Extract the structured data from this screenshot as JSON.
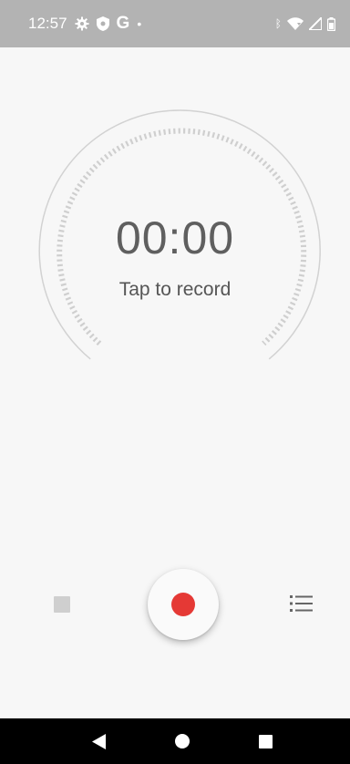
{
  "status_bar": {
    "time": "12:57",
    "left_icons": [
      "settings-gear-icon",
      "shield-icon",
      "google-g-icon",
      "notification-dot-icon"
    ],
    "g_label": "G",
    "dot_label": "•",
    "right_icons": [
      "bluetooth-icon",
      "wifi-icon",
      "signal-icon",
      "battery-icon"
    ],
    "bluetooth_glyph": "ᛒ"
  },
  "recorder": {
    "timer": "00:00",
    "hint": "Tap to record"
  },
  "controls": {
    "stop_icon": "stop-square-icon",
    "record_icon": "record-dot-icon",
    "list_icon": "recordings-list-icon",
    "record_color": "#e53935"
  },
  "nav": {
    "back_icon": "back-triangle-icon",
    "home_icon": "home-circle-icon",
    "recents_icon": "recents-square-icon"
  }
}
